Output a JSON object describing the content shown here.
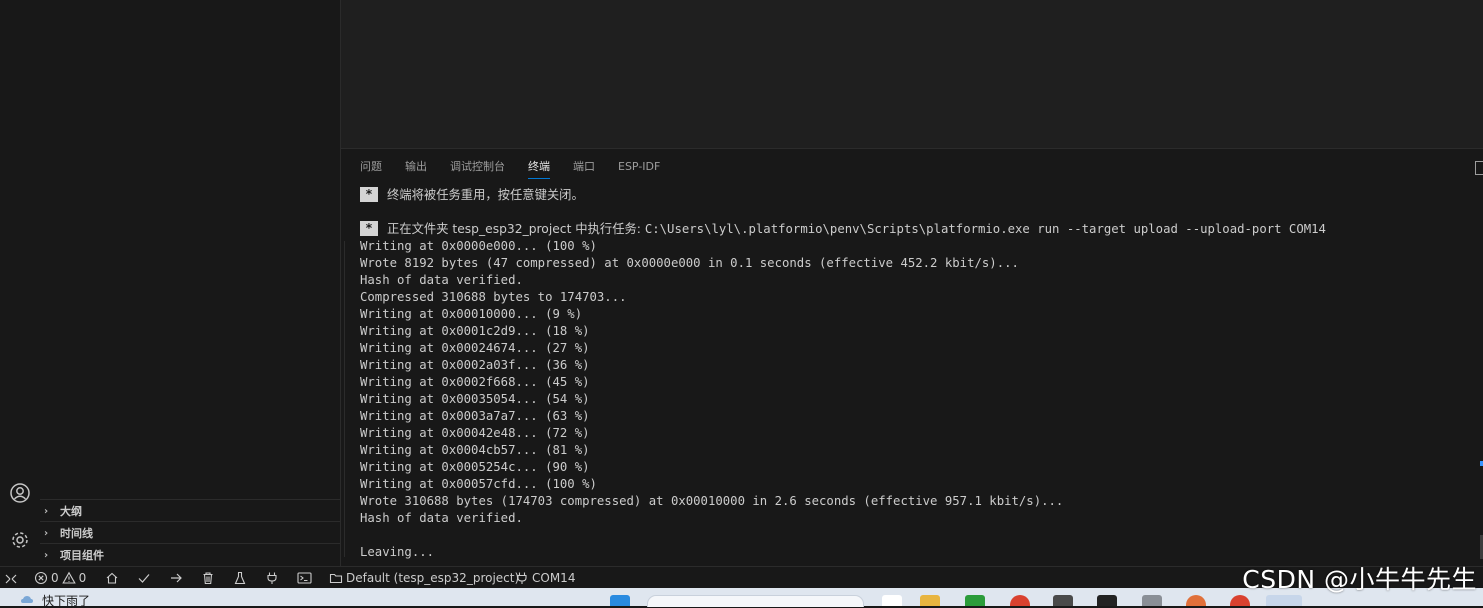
{
  "sidebar": {
    "sections": [
      {
        "label": "大纲"
      },
      {
        "label": "时间线"
      },
      {
        "label": "项目组件"
      }
    ]
  },
  "panel": {
    "tabs": [
      {
        "label": "问题"
      },
      {
        "label": "输出"
      },
      {
        "label": "调试控制台"
      },
      {
        "label": "终端"
      },
      {
        "label": "端口"
      },
      {
        "label": "ESP-IDF"
      }
    ],
    "active_tab": "终端"
  },
  "terminal": {
    "reuse_notice": "终端将被任务重用，按任意键关闭。",
    "task_prefix": "正在文件夹 tesp_esp32_project 中执行任务: ",
    "task_command": "C:\\Users\\lyl\\.platformio\\penv\\Scripts\\platformio.exe run --target upload --upload-port COM14",
    "lines": [
      "Writing at 0x0000e000... (100 %)",
      "Wrote 8192 bytes (47 compressed) at 0x0000e000 in 0.1 seconds (effective 452.2 kbit/s)...",
      "Hash of data verified.",
      "Compressed 310688 bytes to 174703...",
      "Writing at 0x00010000... (9 %)",
      "Writing at 0x0001c2d9... (18 %)",
      "Writing at 0x00024674... (27 %)",
      "Writing at 0x0002a03f... (36 %)",
      "Writing at 0x0002f668... (45 %)",
      "Writing at 0x00035054... (54 %)",
      "Writing at 0x0003a7a7... (63 %)",
      "Writing at 0x00042e48... (72 %)",
      "Writing at 0x0004cb57... (81 %)",
      "Writing at 0x0005254c... (90 %)",
      "Writing at 0x00057cfd... (100 %)",
      "Wrote 310688 bytes (174703 compressed) at 0x00010000 in 2.6 seconds (effective 957.1 kbit/s)...",
      "Hash of data verified.",
      "",
      "Leaving..."
    ]
  },
  "statusbar": {
    "errors": "0",
    "warnings": "0",
    "environment": "Default (tesp_esp32_project)",
    "port": "COM14"
  },
  "taskbar": {
    "weather": "快下雨了"
  },
  "watermark": "CSDN @小牛牛先生",
  "colors": {
    "accent": "#0078d4",
    "background": "#181818",
    "editor": "#1f1f1f"
  }
}
